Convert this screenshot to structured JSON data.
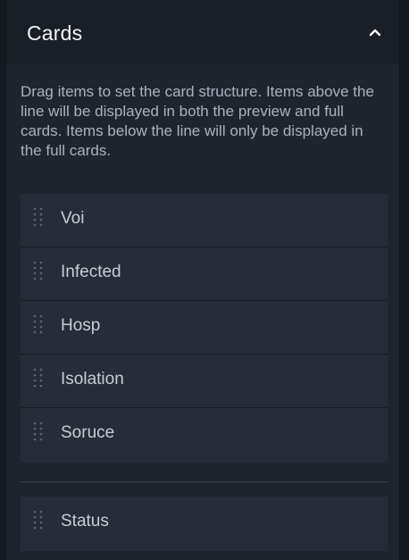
{
  "section": {
    "title": "Cards",
    "collapse_icon": "chevron-up-icon",
    "description": "Drag items to set the card structure. Items above the line will be displayed in both the preview and full cards. Items below the line will only be displayed in the full cards."
  },
  "preview_items": [
    {
      "label": "Voi",
      "icon": "drag-handle-icon"
    },
    {
      "label": "Infected",
      "icon": "drag-handle-icon"
    },
    {
      "label": "Hosp",
      "icon": "drag-handle-icon"
    },
    {
      "label": "Isolation",
      "icon": "drag-handle-icon"
    },
    {
      "label": "Soruce",
      "icon": "drag-handle-icon"
    }
  ],
  "full_only_items": [
    {
      "label": "Status",
      "icon": "drag-handle-icon"
    }
  ],
  "colors": {
    "panel_bg": "#1f252f",
    "header_bg": "#1a1f27",
    "item_bg": "#262d38",
    "text_primary": "#f2f5f8",
    "text_secondary": "#aab2bd",
    "item_text": "#c7cdd5"
  }
}
